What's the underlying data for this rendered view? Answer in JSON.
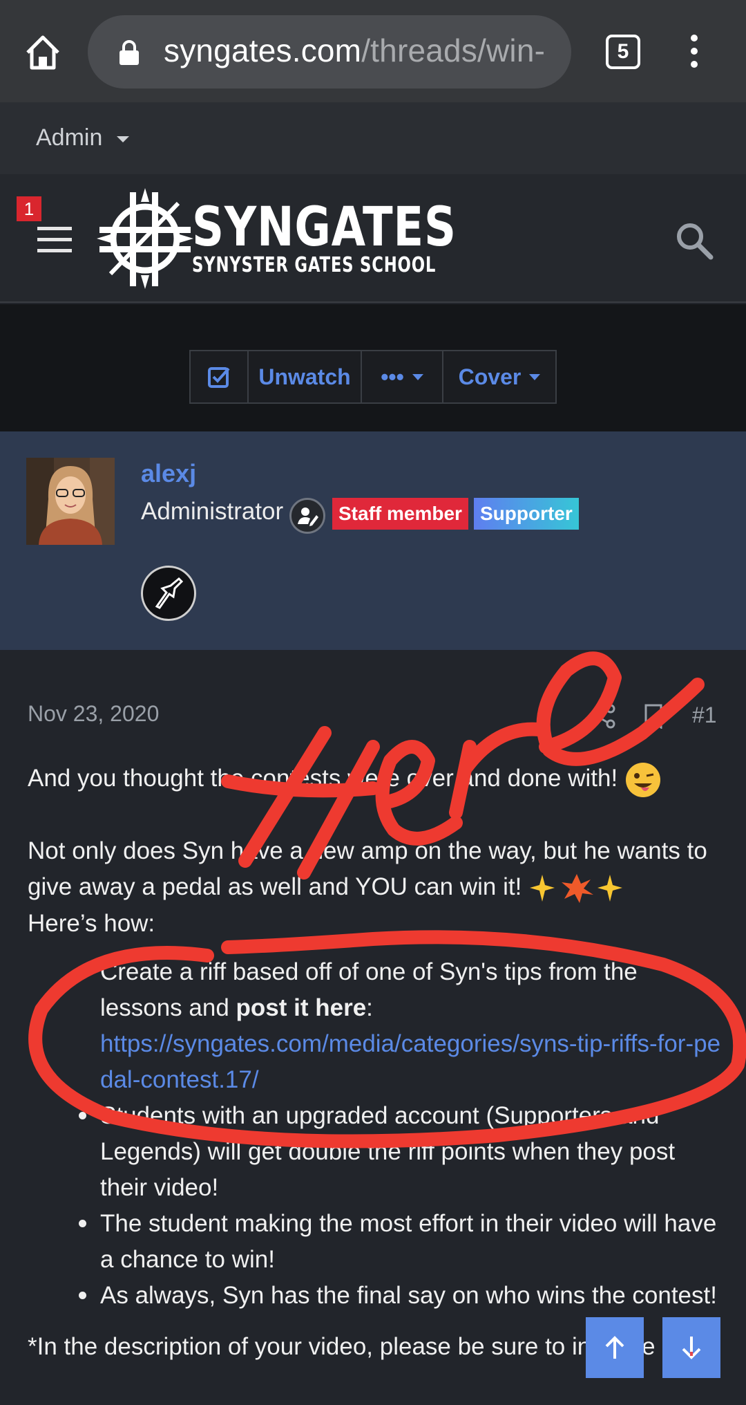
{
  "browser": {
    "url_domain": "syngates.com",
    "url_path": "/threads/win-",
    "tab_count": "5"
  },
  "admin_bar": {
    "label": "Admin"
  },
  "header": {
    "notification_count": "1",
    "logo_title": "SYNGATES",
    "logo_subtitle": "SYNYSTER GATES SCHOOL"
  },
  "toolbar": {
    "unwatch_label": "Unwatch",
    "more_label": "•••",
    "cover_label": "Cover"
  },
  "author": {
    "username": "alexj",
    "title": "Administrator",
    "badges": [
      "Staff member",
      "Supporter"
    ]
  },
  "post": {
    "date": "Nov 23, 2020",
    "number": "#1",
    "p1": "And you thought the contests were over and done with! ",
    "p2": "Not only does Syn have a new amp on the way, but he wants to give away a pedal as well and YOU can win it! ",
    "p3": "Here’s how:",
    "bullet1_before": "Create a riff based off of one of Syn's tips from the lessons and ",
    "bullet1_bold": "post it here",
    "bullet1_after": ":",
    "bullet1_link": "https://syngates.com/media/categories/syns-tip-riffs-for-pedal-contest.17/",
    "bullet2": "Students with an upgraded account (Supporters and Legends) will get double the riff points when they post their video!",
    "bullet3": "The student making the most effort in their video will have a chance to win!",
    "bullet4": "As always, Syn has the final say on who wins the contest!",
    "footnote": "*In the description of your video, please be sure to indicate"
  },
  "annotation": {
    "text": "Here",
    "color": "#ee3a30"
  }
}
